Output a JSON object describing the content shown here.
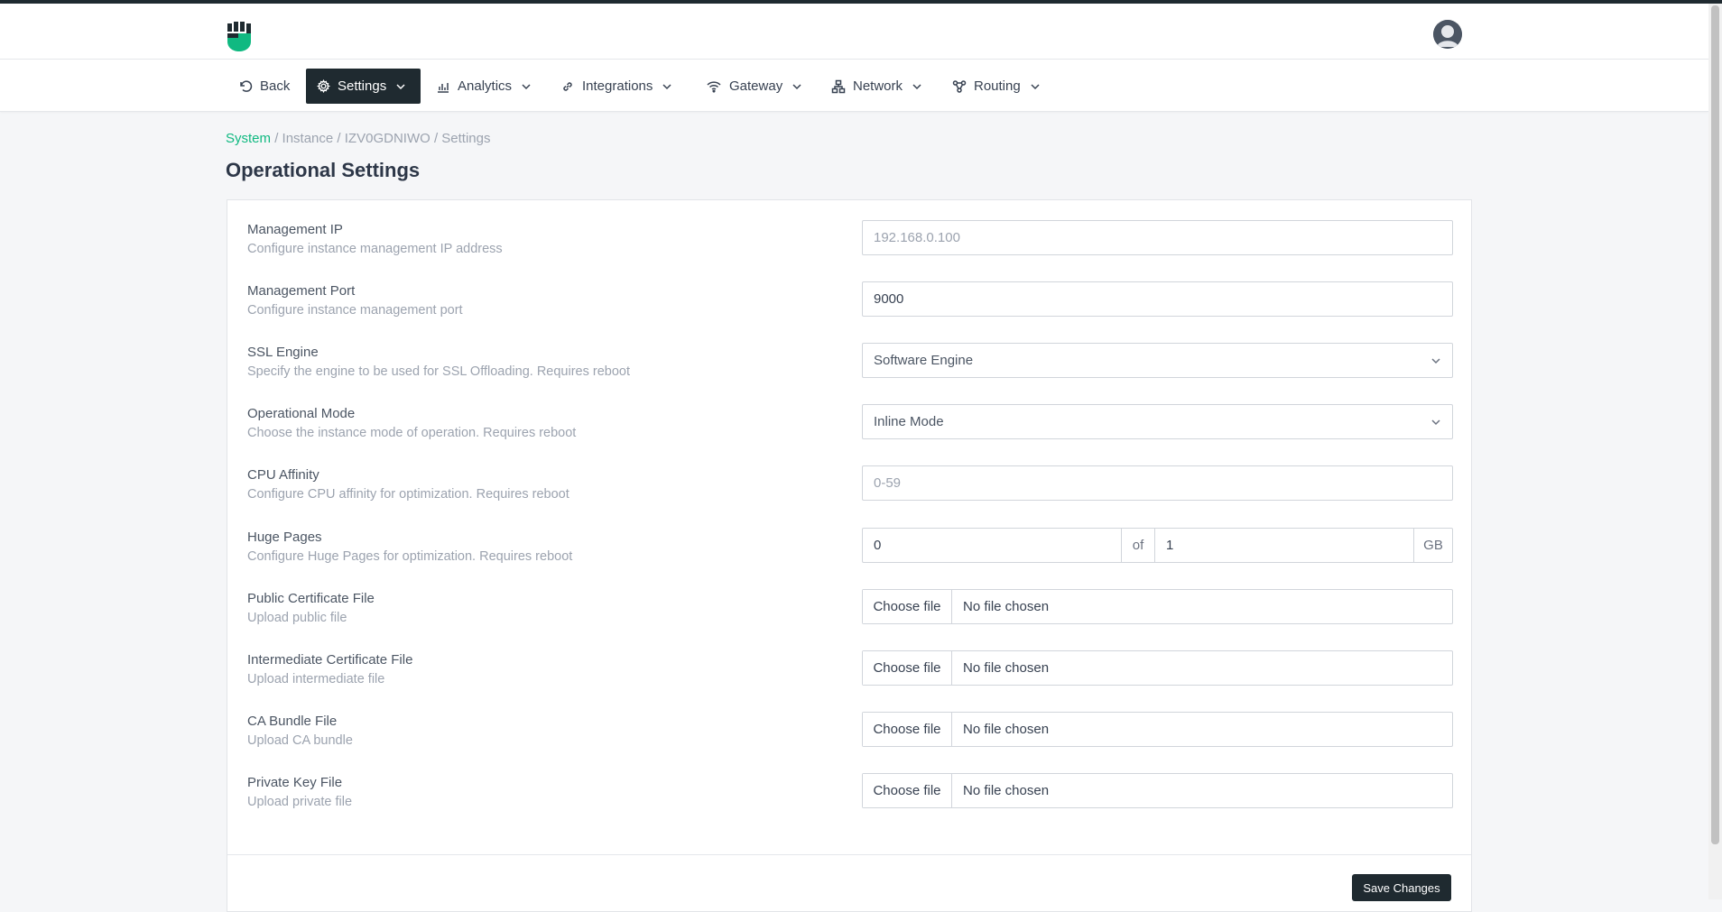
{
  "header": {
    "logo_icon": "fist-logo-icon",
    "avatar_icon": "user-avatar-icon"
  },
  "nav": {
    "back": "Back",
    "settings": "Settings",
    "analytics": "Analytics",
    "integrations": "Integrations",
    "gateway": "Gateway",
    "network": "Network",
    "routing": "Routing"
  },
  "breadcrumb": {
    "system": "System",
    "instance": "Instance",
    "id": "IZV0GDNIWO",
    "settings": "Settings",
    "sep": "/"
  },
  "page": {
    "title": "Operational Settings"
  },
  "form": {
    "management_ip": {
      "label": "Management IP",
      "desc": "Configure instance management IP address",
      "placeholder": "192.168.0.100"
    },
    "management_port": {
      "label": "Management Port",
      "desc": "Configure instance management port",
      "value": "9000"
    },
    "ssl_engine": {
      "label": "SSL Engine",
      "desc": "Specify the engine to be used for SSL Offloading. Requires reboot",
      "value": "Software Engine"
    },
    "operational_mode": {
      "label": "Operational Mode",
      "desc": "Choose the instance mode of operation. Requires reboot",
      "value": "Inline Mode"
    },
    "cpu_affinity": {
      "label": "CPU Affinity",
      "desc": "Configure CPU affinity for optimization. Requires reboot",
      "placeholder": "0-59"
    },
    "huge_pages": {
      "label": "Huge Pages",
      "desc": "Configure Huge Pages for optimization. Requires reboot",
      "value": "0",
      "of": "of",
      "total": "1",
      "unit": "GB"
    },
    "public_cert": {
      "label": "Public Certificate File",
      "desc": "Upload public file",
      "button": "Choose file",
      "status": "No file chosen"
    },
    "intermediate_cert": {
      "label": "Intermediate Certificate File",
      "desc": "Upload intermediate file",
      "button": "Choose file",
      "status": "No file chosen"
    },
    "ca_bundle": {
      "label": "CA Bundle File",
      "desc": "Upload CA bundle",
      "button": "Choose file",
      "status": "No file chosen"
    },
    "private_key": {
      "label": "Private Key File",
      "desc": "Upload private file",
      "button": "Choose file",
      "status": "No file chosen"
    }
  },
  "actions": {
    "save": "Save Changes"
  },
  "colors": {
    "dark": "#1f2a30",
    "accent": "#10b981"
  }
}
